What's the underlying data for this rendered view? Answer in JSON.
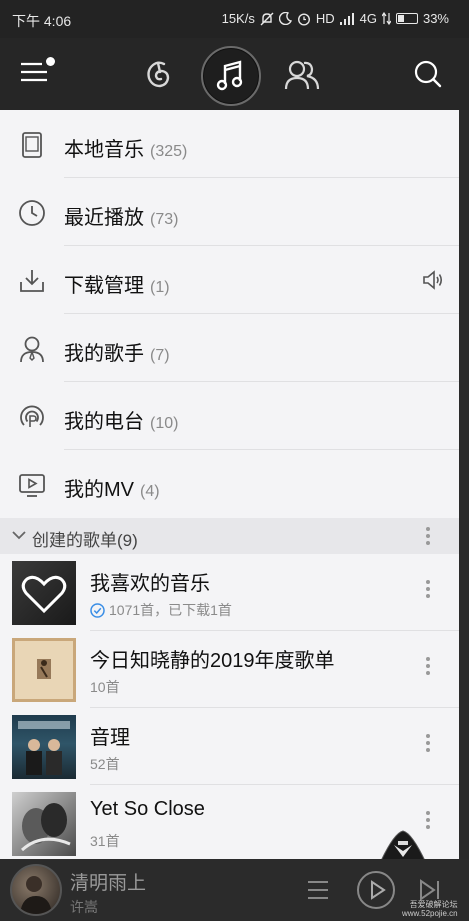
{
  "status_bar": {
    "time": "下午 4:06",
    "speed": "15K/s",
    "hd": "HD",
    "network": "4G",
    "battery": "33%",
    "battery_level": 0.33
  },
  "header": {
    "icons": [
      "menu-icon",
      "netease-discover-icon",
      "music-note-icon",
      "friends-icon",
      "search-icon"
    ]
  },
  "menu": {
    "items": [
      {
        "label": "本地音乐",
        "count": "(325)",
        "icon": "phone-icon"
      },
      {
        "label": "最近播放",
        "count": "(73)",
        "icon": "clock-icon"
      },
      {
        "label": "下载管理",
        "count": "(1)",
        "icon": "download-icon"
      },
      {
        "label": "我的歌手",
        "count": "(7)",
        "icon": "singer-icon"
      },
      {
        "label": "我的电台",
        "count": "(10)",
        "icon": "radio-icon"
      },
      {
        "label": "我的MV",
        "count": "(4)",
        "icon": "tv-icon"
      }
    ]
  },
  "section": {
    "title": "创建的歌单(9)"
  },
  "playlists": [
    {
      "name": "我喜欢的音乐",
      "meta": "1071首，已下载1首",
      "downloaded": true
    },
    {
      "name": "今日知晓静的2019年度歌单",
      "meta": "10首",
      "downloaded": false
    },
    {
      "name": "音理",
      "meta": "52首",
      "downloaded": false
    },
    {
      "name": "Yet So Close",
      "meta": "31首",
      "downloaded": false
    }
  ],
  "player": {
    "title": "清明雨上",
    "artist": "许嵩"
  },
  "watermark": {
    "line1": "吾爱破解论坛",
    "line2": "www.52pojie.cn"
  },
  "colors": {
    "accent_dark": "#262626",
    "background": "#f4f4f6",
    "check_blue": "#3a8ee6"
  }
}
